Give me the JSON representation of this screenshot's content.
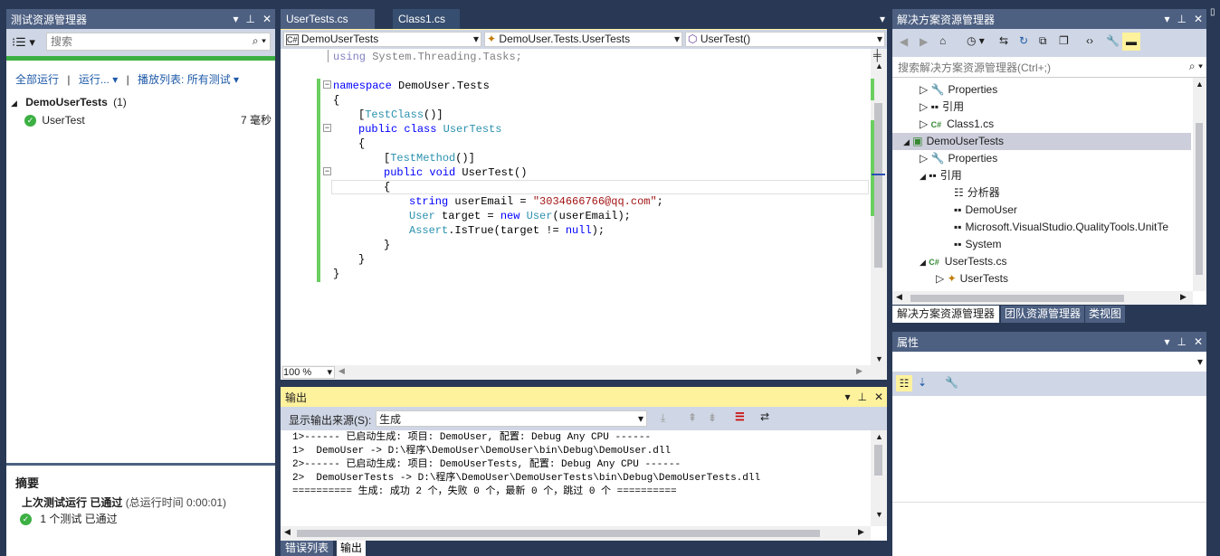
{
  "test_explorer": {
    "title": "测试资源管理器",
    "search_placeholder": "搜索",
    "run_all": "全部运行",
    "run": "运行...",
    "playlist": "播放列表: 所有测试",
    "group_name": "DemoUserTests",
    "group_count": "(1)",
    "test_name": "UserTest",
    "test_duration": "7 毫秒",
    "summary_title": "摘要",
    "last_run_label": "上次测试运行 已通过",
    "total_time": "(总运行时间 0:00:01)",
    "passed_count": "1 个测试 已通过",
    "progress_color": "#3cb043"
  },
  "editor": {
    "tabs": [
      {
        "label": "UserTests.cs",
        "active": true
      },
      {
        "label": "Class1.cs",
        "active": false
      }
    ],
    "nav_project": "DemoUserTests",
    "nav_class": "DemoUser.Tests.UserTests",
    "nav_member": "UserTest()",
    "zoom": "100 %",
    "code": {
      "l1_kw": "using",
      "l1_rest": " System.Threading.Tasks;",
      "l2_kw": "namespace",
      "l2_rest": " DemoUser.Tests",
      "open_brace": "{",
      "close_brace": "}",
      "attr_class": "TestClass",
      "paren": "()",
      "lb": "[",
      "rb": "]",
      "public": "public",
      "class": "class",
      "class_name": "UserTests",
      "attr_method": "TestMethod",
      "void": "void",
      "method_name": " UserTest()",
      "string": "string",
      "email_var": " userEmail = ",
      "email_val": "\"3034666766@qq.com\"",
      "semicolon": ";",
      "user_type": "User",
      "target_var": " target = ",
      "new": "new",
      "ctor_args": "(userEmail);",
      "assert_type": "Assert",
      "is_true": ".IsTrue(target != ",
      "null": "null",
      "end_call": ");"
    }
  },
  "output": {
    "title": "输出",
    "source_label": "显示输出来源(S):",
    "source_value": "生成",
    "lines": [
      "1>------ 已启动生成: 项目: DemoUser, 配置: Debug Any CPU ------",
      "1>  DemoUser -> D:\\程序\\DemoUser\\DemoUser\\bin\\Debug\\DemoUser.dll",
      "2>------ 已启动生成: 项目: DemoUserTests, 配置: Debug Any CPU ------",
      "2>  DemoUserTests -> D:\\程序\\DemoUser\\DemoUserTests\\bin\\Debug\\DemoUserTests.dll",
      "========== 生成: 成功 2 个，失败 0 个，最新 0 个，跳过 0 个 =========="
    ],
    "bottom_tabs": [
      "错误列表",
      "输出"
    ]
  },
  "solution_explorer": {
    "title": "解决方案资源管理器",
    "search_placeholder": "搜索解决方案资源管理器(Ctrl+;)",
    "items": [
      {
        "label": "Properties",
        "icon": "wrench-icon"
      },
      {
        "label": "引用",
        "icon": "reference-icon"
      },
      {
        "label": "Class1.cs",
        "icon": "csharp-file-icon"
      },
      {
        "label": "DemoUserTests",
        "icon": "test-project-icon"
      },
      {
        "label": "Properties",
        "icon": "wrench-icon"
      },
      {
        "label": "引用",
        "icon": "reference-icon"
      },
      {
        "label": "分析器",
        "icon": "analyzer-icon"
      },
      {
        "label": "DemoUser",
        "icon": "reference-icon"
      },
      {
        "label": "Microsoft.VisualStudio.QualityTools.UnitTe",
        "icon": "reference-icon"
      },
      {
        "label": "System",
        "icon": "reference-icon"
      },
      {
        "label": "UserTests.cs",
        "icon": "csharp-file-icon"
      },
      {
        "label": "UserTests",
        "icon": "class-icon"
      }
    ],
    "bottom_tabs": [
      "解决方案资源管理器",
      "团队资源管理器",
      "类视图"
    ]
  },
  "properties": {
    "title": "属性"
  }
}
